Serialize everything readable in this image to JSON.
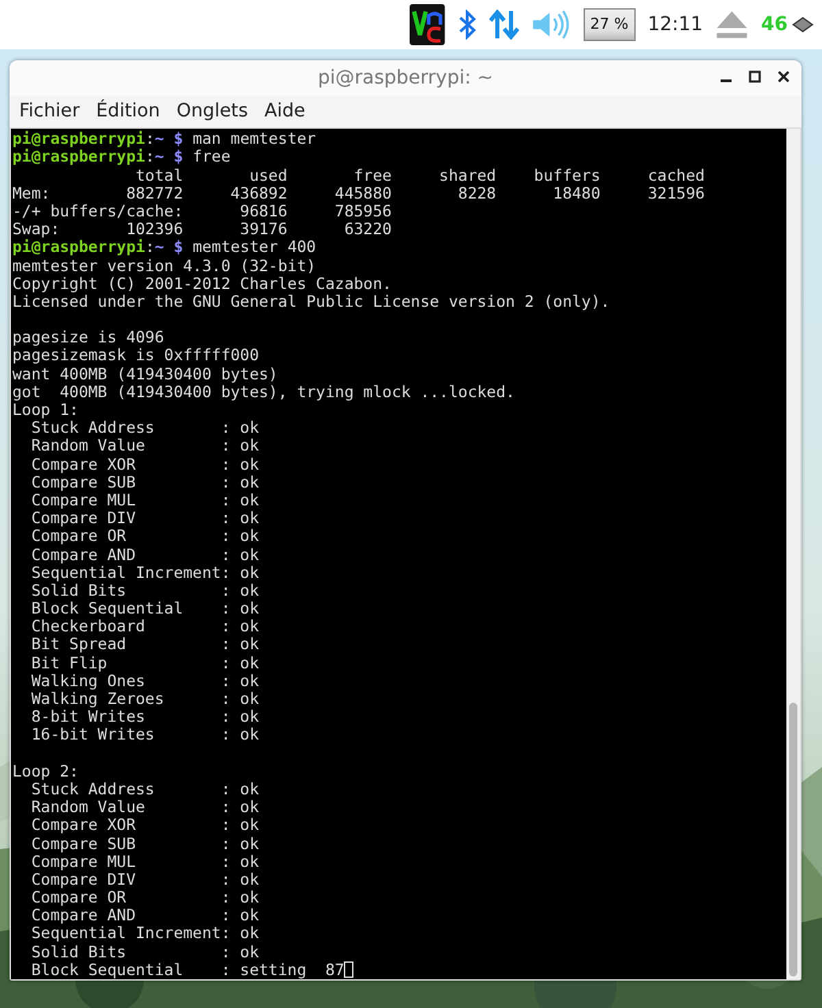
{
  "panel": {
    "cpu": "27 %",
    "clock": "12:11",
    "indicator": "46"
  },
  "window": {
    "title": "pi@raspberrypi: ~"
  },
  "menu": [
    "Fichier",
    "Édition",
    "Onglets",
    "Aide"
  ],
  "terminal": {
    "lines": [
      {
        "kind": "prompt",
        "user": "pi@raspberrypi",
        "colon": ":",
        "path": "~ $",
        "command": "man memtester"
      },
      {
        "kind": "prompt",
        "user": "pi@raspberrypi",
        "colon": ":",
        "path": "~ $",
        "command": "free"
      },
      {
        "kind": "output",
        "text": "             total       used       free     shared    buffers     cached"
      },
      {
        "kind": "output",
        "text": "Mem:        882772     436892     445880       8228      18480     321596"
      },
      {
        "kind": "output",
        "text": "-/+ buffers/cache:      96816     785956"
      },
      {
        "kind": "output",
        "text": "Swap:       102396      39176      63220"
      },
      {
        "kind": "prompt",
        "user": "pi@raspberrypi",
        "colon": ":",
        "path": "~ $",
        "command": "memtester 400"
      },
      {
        "kind": "output",
        "text": "memtester version 4.3.0 (32-bit)"
      },
      {
        "kind": "output",
        "text": "Copyright (C) 2001-2012 Charles Cazabon."
      },
      {
        "kind": "output",
        "text": "Licensed under the GNU General Public License version 2 (only)."
      },
      {
        "kind": "blank"
      },
      {
        "kind": "output",
        "text": "pagesize is 4096"
      },
      {
        "kind": "output",
        "text": "pagesizemask is 0xfffff000"
      },
      {
        "kind": "output",
        "text": "want 400MB (419430400 bytes)"
      },
      {
        "kind": "output",
        "text": "got  400MB (419430400 bytes), trying mlock ...locked."
      },
      {
        "kind": "output",
        "text": "Loop 1:"
      },
      {
        "kind": "output",
        "text": "  Stuck Address       : ok"
      },
      {
        "kind": "output",
        "text": "  Random Value        : ok"
      },
      {
        "kind": "output",
        "text": "  Compare XOR         : ok"
      },
      {
        "kind": "output",
        "text": "  Compare SUB         : ok"
      },
      {
        "kind": "output",
        "text": "  Compare MUL         : ok"
      },
      {
        "kind": "output",
        "text": "  Compare DIV         : ok"
      },
      {
        "kind": "output",
        "text": "  Compare OR          : ok"
      },
      {
        "kind": "output",
        "text": "  Compare AND         : ok"
      },
      {
        "kind": "output",
        "text": "  Sequential Increment: ok"
      },
      {
        "kind": "output",
        "text": "  Solid Bits          : ok"
      },
      {
        "kind": "output",
        "text": "  Block Sequential    : ok"
      },
      {
        "kind": "output",
        "text": "  Checkerboard        : ok"
      },
      {
        "kind": "output",
        "text": "  Bit Spread          : ok"
      },
      {
        "kind": "output",
        "text": "  Bit Flip            : ok"
      },
      {
        "kind": "output",
        "text": "  Walking Ones        : ok"
      },
      {
        "kind": "output",
        "text": "  Walking Zeroes      : ok"
      },
      {
        "kind": "output",
        "text": "  8-bit Writes        : ok"
      },
      {
        "kind": "output",
        "text": "  16-bit Writes       : ok"
      },
      {
        "kind": "blank"
      },
      {
        "kind": "output",
        "text": "Loop 2:"
      },
      {
        "kind": "output",
        "text": "  Stuck Address       : ok"
      },
      {
        "kind": "output",
        "text": "  Random Value        : ok"
      },
      {
        "kind": "output",
        "text": "  Compare XOR         : ok"
      },
      {
        "kind": "output",
        "text": "  Compare SUB         : ok"
      },
      {
        "kind": "output",
        "text": "  Compare MUL         : ok"
      },
      {
        "kind": "output",
        "text": "  Compare DIV         : ok"
      },
      {
        "kind": "output",
        "text": "  Compare OR          : ok"
      },
      {
        "kind": "output",
        "text": "  Compare AND         : ok"
      },
      {
        "kind": "output",
        "text": "  Sequential Increment: ok"
      },
      {
        "kind": "output",
        "text": "  Solid Bits          : ok"
      },
      {
        "kind": "cursor",
        "text": "  Block Sequential    : setting  87"
      }
    ]
  }
}
